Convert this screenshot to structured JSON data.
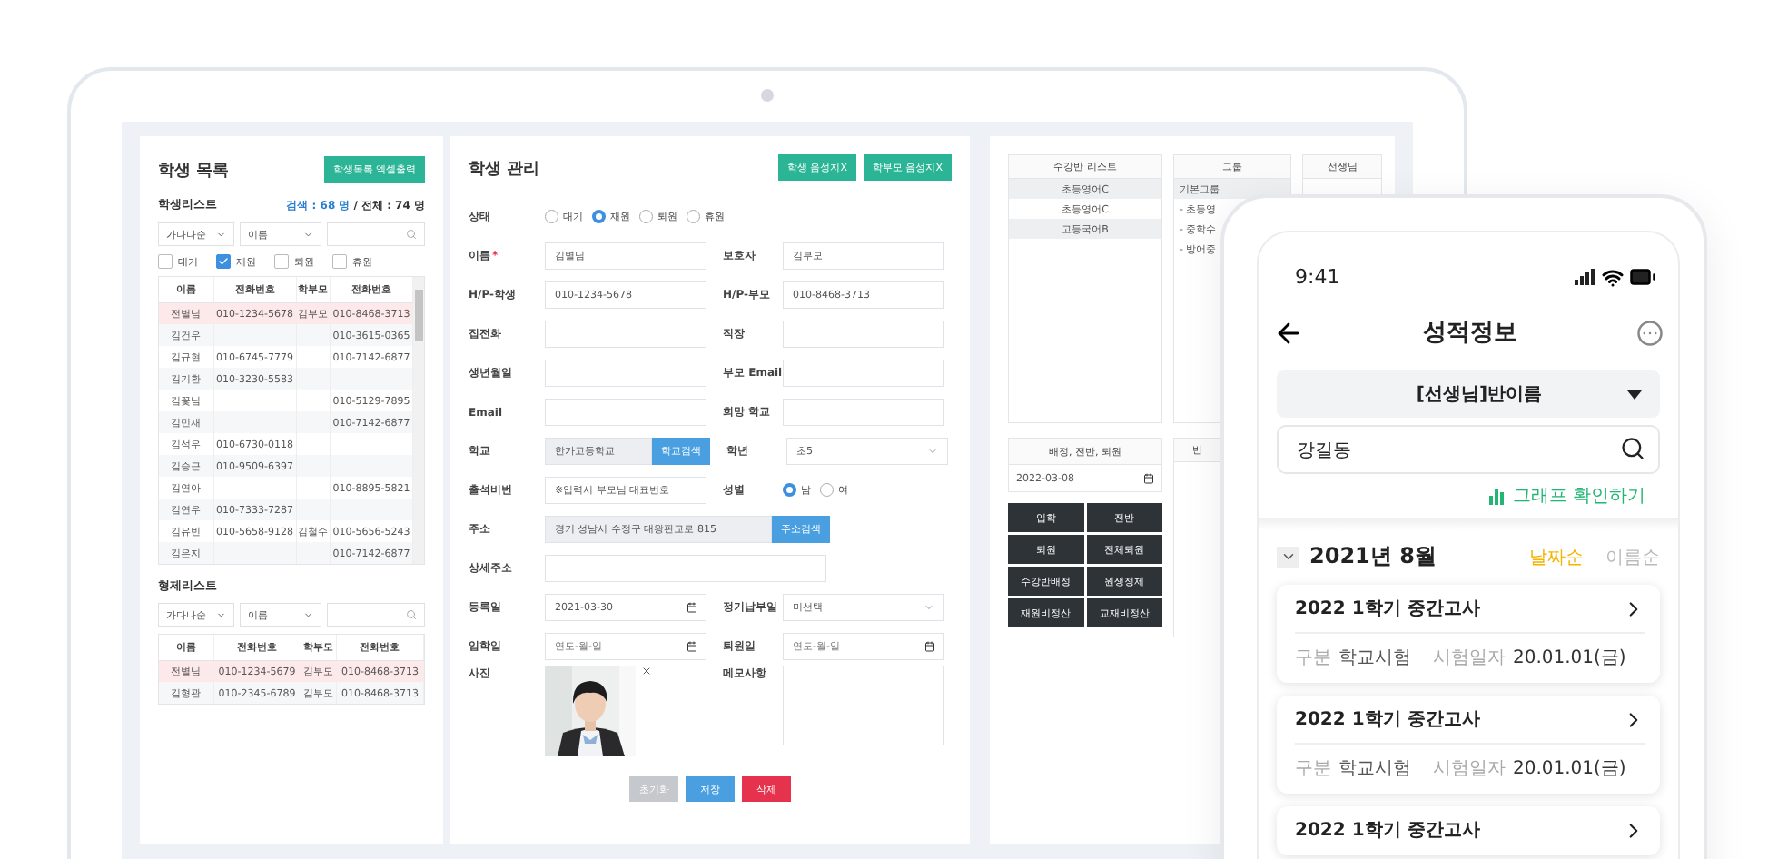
{
  "admin": {
    "student_panel": {
      "title": "학생 목록",
      "export_button": "학생목록 엑셀출력",
      "list_title": "학생리스트",
      "search_count": "검색 : 68 명",
      "total_count": "/ 전체 : 74 명",
      "sort_select": "가다나순",
      "field_select": "이름",
      "filters": [
        {
          "label": "대기",
          "checked": false
        },
        {
          "label": "재원",
          "checked": true
        },
        {
          "label": "퇴원",
          "checked": false
        },
        {
          "label": "휴원",
          "checked": false
        }
      ],
      "table": {
        "columns": [
          "이름",
          "전화번호",
          "학부모",
          "전화번호"
        ],
        "rows": [
          {
            "name": "전별님",
            "phone": "010-1234-5678",
            "parent": "김부모",
            "parent_phone": "010-8468-3713",
            "selected": true
          },
          {
            "name": "김건우",
            "parent_phone": "010-3615-0365",
            "selected": false
          },
          {
            "name": "김규현",
            "phone": "010-6745-7779",
            "parent_phone": "010-7142-6877",
            "selected": false
          },
          {
            "name": "김기환",
            "phone": "010-3230-5583",
            "selected": false
          },
          {
            "name": "김꽃님",
            "parent_phone": "010-5129-7895",
            "selected": false
          },
          {
            "name": "김민재",
            "parent_phone": "010-7142-6877",
            "selected": false
          },
          {
            "name": "김석우",
            "phone": "010-6730-0118",
            "selected": false
          },
          {
            "name": "김승근",
            "phone": "010-9509-6397",
            "selected": false
          },
          {
            "name": "김연아",
            "parent_phone": "010-8895-5821",
            "selected": false
          },
          {
            "name": "김연우",
            "phone": "010-7333-7287",
            "selected": false
          },
          {
            "name": "김유빈",
            "phone": "010-5658-9128",
            "parent": "김철수",
            "parent_phone": "010-5656-5243",
            "selected": false
          },
          {
            "name": "김은지",
            "parent_phone": "010-7142-6877",
            "selected": false
          }
        ]
      }
    },
    "sibling_panel": {
      "title": "형제리스트",
      "sort_select": "가다나순",
      "field_select": "이름",
      "table": {
        "columns": [
          "이름",
          "전화번호",
          "학부모",
          "전화번호"
        ],
        "rows": [
          {
            "name": "전별님",
            "phone": "010-1234-5679",
            "parent": "김부모",
            "parent_phone": "010-8468-3713",
            "selected": true
          },
          {
            "name": "김형관",
            "phone": "010-2345-6789",
            "parent": "김부모",
            "parent_phone": "010-8468-3713",
            "selected": false
          }
        ]
      }
    },
    "form": {
      "title": "학생 관리",
      "header_buttons": [
        "학생 음성지X",
        "학부모 음성지X"
      ],
      "rows": [
        {
          "fields": [
            {
              "kind": "radio",
              "label": "상태",
              "options": [
                {
                  "label": "대기",
                  "selected": false
                },
                {
                  "label": "재원",
                  "selected": true
                },
                {
                  "label": "퇴원",
                  "selected": false
                },
                {
                  "label": "휴원",
                  "selected": false
                }
              ]
            }
          ]
        },
        {
          "fields": [
            {
              "kind": "text",
              "label": "이름",
              "mark": "*",
              "value": "김별님"
            },
            {
              "kind": "text",
              "label": "보호자",
              "value": "김부모"
            }
          ]
        },
        {
          "fields": [
            {
              "kind": "text",
              "label": "H/P-학생",
              "value": "010-1234-5678"
            },
            {
              "kind": "text",
              "label": "H/P-부모",
              "value": "010-8468-3713"
            }
          ]
        },
        {
          "fields": [
            {
              "kind": "text",
              "label": "집전화"
            },
            {
              "kind": "text",
              "label": "직장"
            }
          ]
        },
        {
          "fields": [
            {
              "kind": "text",
              "label": "생년월일"
            },
            {
              "kind": "text",
              "label": "부모 Email"
            }
          ]
        },
        {
          "fields": [
            {
              "kind": "text",
              "label": "Email"
            },
            {
              "kind": "text",
              "label": "희망 학교"
            }
          ]
        },
        {
          "fields": [
            {
              "kind": "search",
              "label": "학교",
              "value": "한가고등학교",
              "button": "학교검색"
            },
            {
              "kind": "select",
              "label": "학년",
              "value": "초5"
            }
          ]
        },
        {
          "fields": [
            {
              "kind": "text",
              "label": "출석비번",
              "value": "※입력시 부모님 대표번호"
            },
            {
              "kind": "radio",
              "label": "성별",
              "options": [
                {
                  "label": "남",
                  "selected": true
                },
                {
                  "label": "여",
                  "selected": false
                }
              ]
            }
          ]
        },
        {
          "fields": [
            {
              "kind": "search",
              "label": "주소",
              "value": "경기 성남시 수정구 대왕판교로 815",
              "button": "주소검색"
            }
          ]
        },
        {
          "fields": [
            {
              "kind": "text",
              "label": "상세주소"
            }
          ]
        },
        {
          "fields": [
            {
              "kind": "date",
              "label": "등록일",
              "value": "2021-03-30"
            },
            {
              "kind": "select",
              "label": "정기납부일",
              "value": "미선택"
            }
          ]
        },
        {
          "fields": [
            {
              "kind": "date",
              "label": "입학일",
              "placeholder": "연도-월-일"
            },
            {
              "kind": "date",
              "label": "퇴원일",
              "placeholder": "연도-월-일"
            }
          ]
        },
        {
          "fields": [
            {
              "label": "사진"
            },
            {
              "kind": "memo",
              "label": "메모사항"
            }
          ]
        }
      ],
      "actions": [
        {
          "label": "초기화",
          "kind": "reset"
        },
        {
          "label": "저장",
          "kind": "save"
        },
        {
          "label": "삭제",
          "kind": "delete"
        }
      ]
    },
    "class_list": {
      "title": "수강반 리스트",
      "items": [
        "초등영어C",
        "초등영어C",
        "고등국어B"
      ]
    },
    "group_list": {
      "title": "그룹",
      "items": [
        {
          "label": "기본그룹",
          "selected": true
        },
        {
          "label": "- 초등영",
          "selected": false
        },
        {
          "label": "- 중학수",
          "selected": false
        },
        {
          "label": "- 방어중",
          "selected": false
        }
      ]
    },
    "teacher_list": {
      "title": "선생님"
    },
    "assign_panel": {
      "title": "배정, 전반, 퇴원",
      "date": "2022-03-08",
      "buttons": [
        "입학",
        "전반",
        "퇴원",
        "전체퇴원",
        "수강반배정",
        "원생정제",
        "재원비정산",
        "교재비정산"
      ]
    },
    "class_panel": {
      "title": "반"
    }
  },
  "mobile": {
    "time": "9:41",
    "title": "성적정보",
    "class_select": "[선생님]반이름",
    "search": {
      "value": "강길동"
    },
    "graph_link": "그래프 확인하기",
    "month": "2021년 8월",
    "sort_options": [
      {
        "label": "날짜순",
        "selected": true
      },
      {
        "label": "이름순",
        "selected": false
      }
    ],
    "exams": [
      {
        "title": "2022 1학기 중간고사",
        "type_label": "구분",
        "type": "학교시험",
        "date_label": "시험일자",
        "date": "20.01.01(금)"
      },
      {
        "title": "2022 1학기 중간고사",
        "type_label": "구분",
        "type": "학교시험",
        "date_label": "시험일자",
        "date": "20.01.01(금)"
      },
      {
        "title": "2022 1학기 중간고사"
      }
    ]
  }
}
